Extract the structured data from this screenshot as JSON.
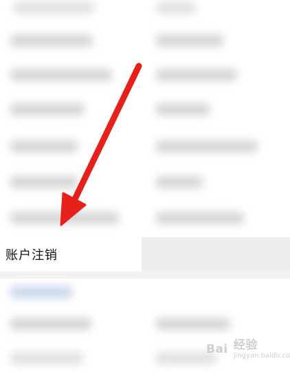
{
  "screen": {
    "highlighted_item": {
      "label": "账户注销"
    },
    "watermark": {
      "brand_left": "Bai",
      "brand_right": "经验",
      "domain": "jingyan.baidu.com",
      "icon": "paw-icon"
    },
    "annotation": {
      "icon": "red-arrow-icon",
      "color": "#e8201a"
    }
  }
}
